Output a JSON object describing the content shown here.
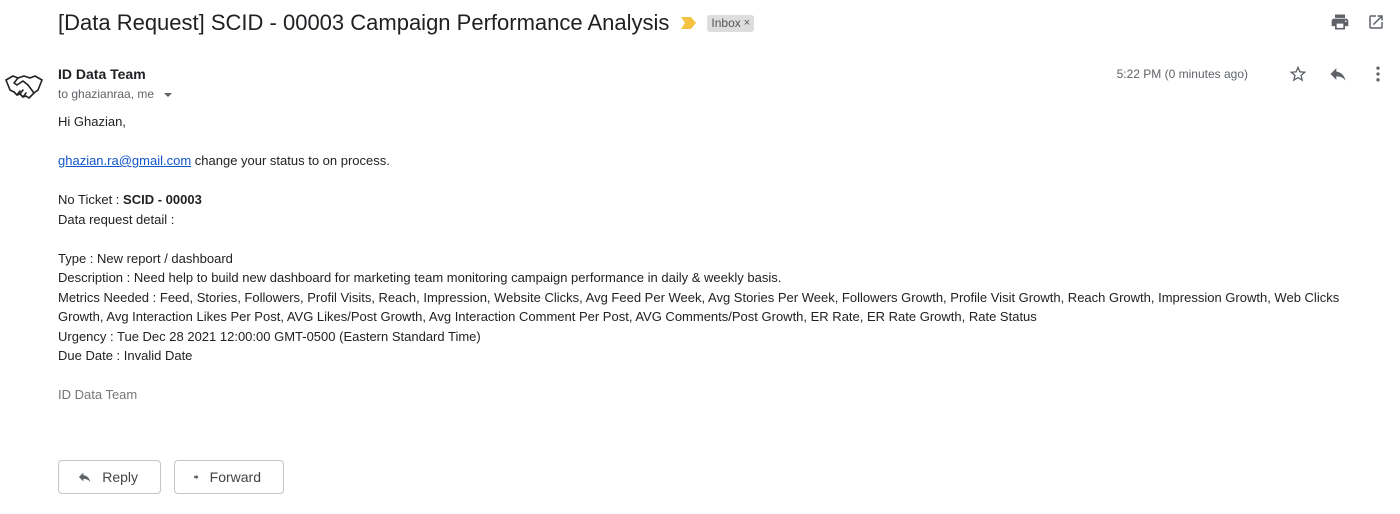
{
  "email": {
    "subject": "[Data Request] SCID - 00003 Campaign Performance Analysis",
    "label": "Inbox",
    "label_remove": "×",
    "sender": "ID Data Team",
    "recipients": "to ghazianraa, me",
    "timestamp": "5:22 PM (0 minutes ago)",
    "body": {
      "greeting": "Hi Ghazian,",
      "link_email": "ghazian.ra@gmail.com",
      "status_text": " change your status to on process.",
      "ticket_label": "No Ticket : ",
      "ticket_id": "SCID - 00003",
      "detail_heading": "Data request detail :",
      "type_line": "Type : New report / dashboard",
      "description_line": "Description : Need help to build new dashboard for marketing team monitoring campaign performance in daily & weekly basis.",
      "metrics_line": "Metrics Needed : Feed, Stories, Followers, Profil Visits, Reach, Impression, Website Clicks, Avg Feed Per Week, Avg Stories Per Week, Followers Growth, Profile Visit Growth, Reach Growth, Impression Growth, Web Clicks Growth, Avg Interaction Likes Per Post, AVG Likes/Post Growth, Avg Interaction Comment Per Post, AVG Comments/Post Growth, ER Rate, ER Rate Growth, Rate Status",
      "urgency_line": "Urgency : Tue Dec 28 2021 12:00:00 GMT-0500 (Eastern Standard Time)",
      "due_line": "Due Date : Invalid Date",
      "signature": "ID Data Team"
    }
  },
  "actions": {
    "reply_label": "Reply",
    "forward_label": "Forward"
  },
  "icons": {
    "importance": "importance-marker-icon",
    "print": "print-icon",
    "open_new_window": "open-in-new-window-icon",
    "avatar": "handshake-icon",
    "star": "star-icon",
    "reply": "reply-icon",
    "more": "more-vertical-icon",
    "forward": "forward-icon"
  },
  "colors": {
    "importance": "#f5c342",
    "link": "#1155cc",
    "chip_bg": "#dddddd",
    "signature": "#777777"
  }
}
